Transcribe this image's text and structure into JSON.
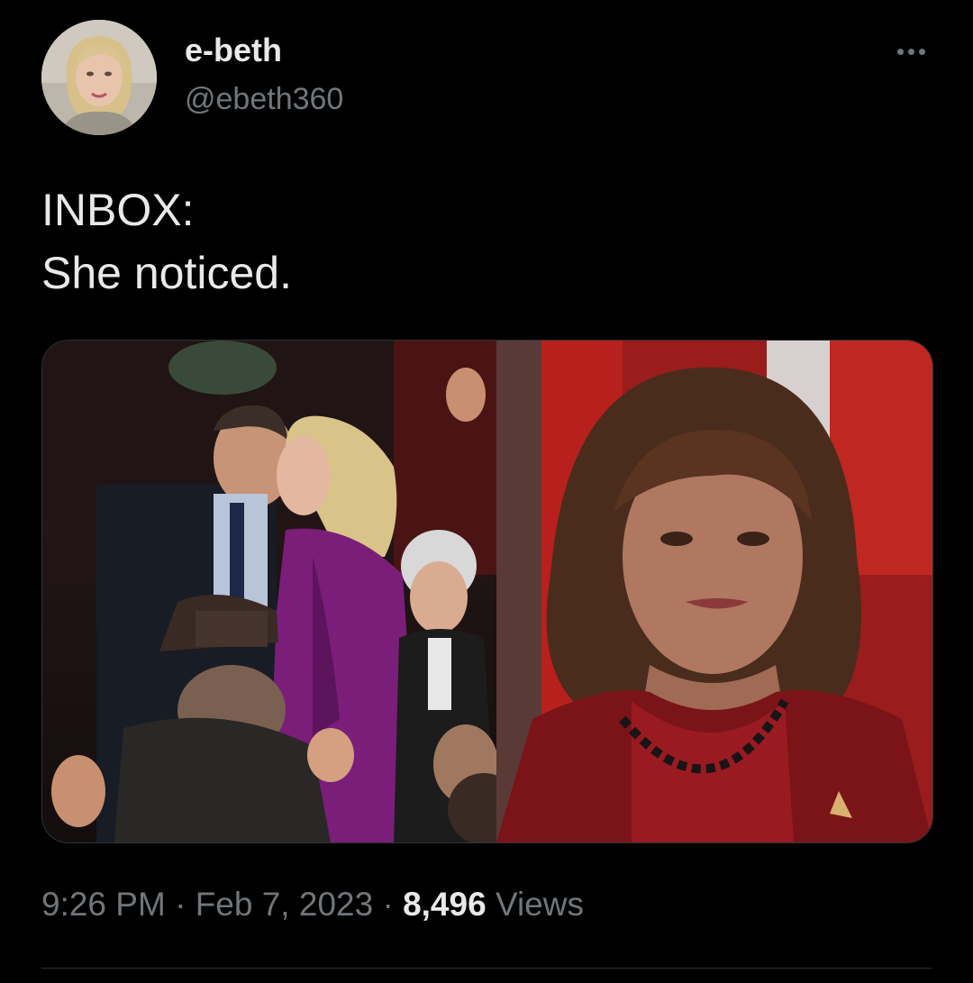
{
  "author": {
    "display_name": "e-beth",
    "handle": "@ebeth360"
  },
  "icons": {
    "more": "more-horizontal-icon"
  },
  "tweet": {
    "line1": "INBOX:",
    "line2": "She noticed."
  },
  "meta": {
    "time": "9:26 PM",
    "separator": "·",
    "date": "Feb 7, 2023",
    "views_count": "8,496",
    "views_label": "Views"
  },
  "colors": {
    "background": "#000000",
    "primary_text": "#e7e9ea",
    "secondary_text": "#71767b",
    "border": "#2f3336"
  }
}
